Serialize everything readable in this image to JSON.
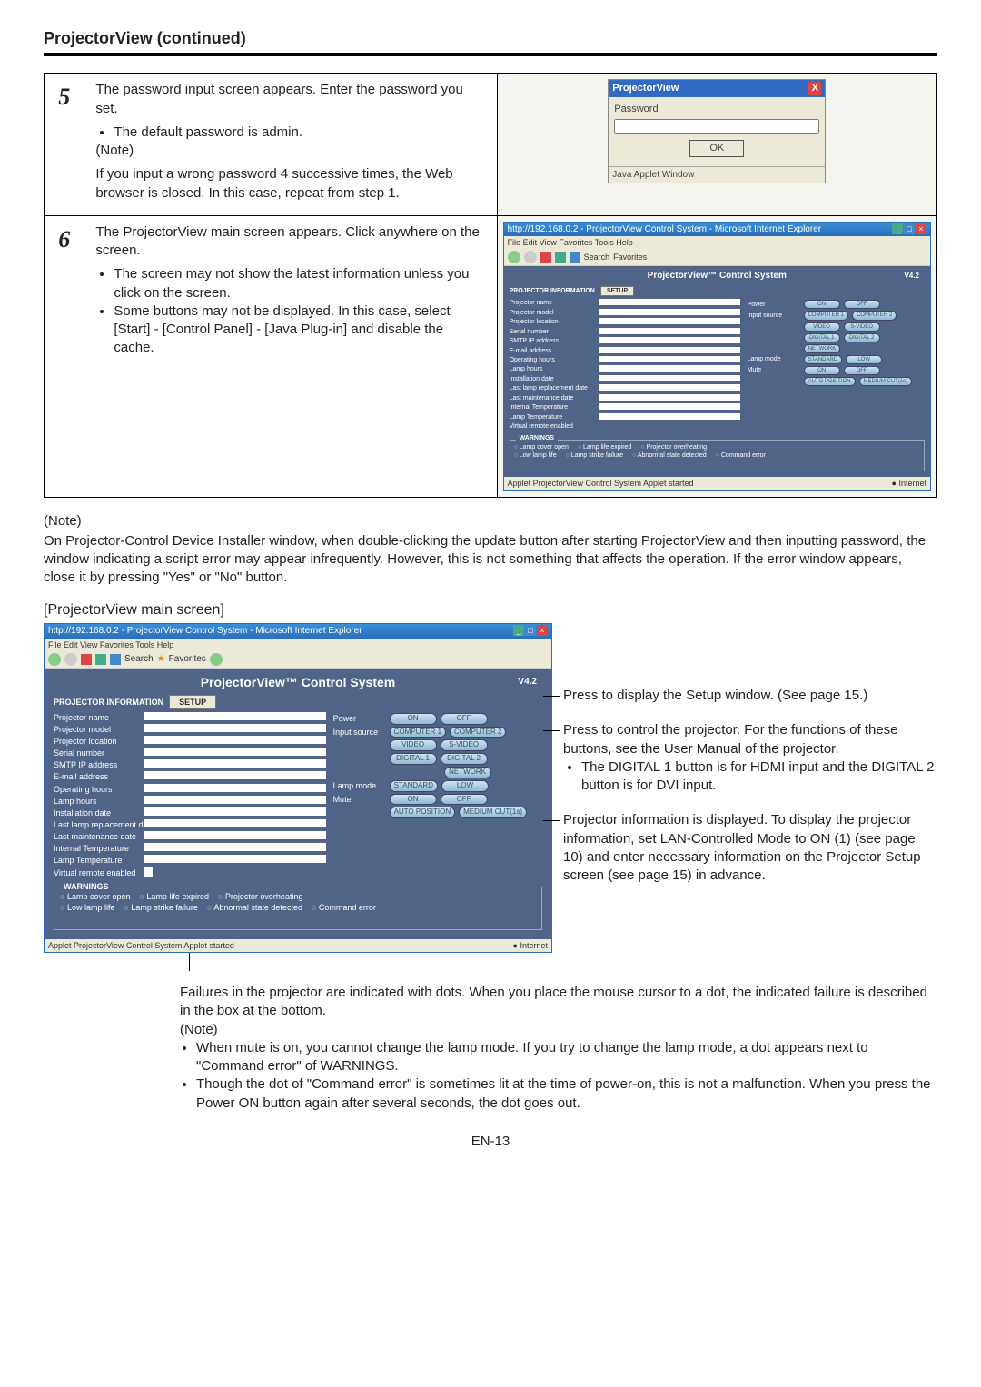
{
  "page": {
    "title": "ProjectorView (continued)",
    "footer": "EN-13",
    "subheading": "[ProjectorView main screen]"
  },
  "step5": {
    "num": "5",
    "p1": "The password input screen appears. Enter the password you set.",
    "li1": "The default password is admin.",
    "note_label": "(Note)",
    "p2": "If you input a wrong password 4 successive times, the Web browser is closed. In this case, repeat from step 1.",
    "dlg": {
      "title": "ProjectorView",
      "close": "X",
      "label": "Password",
      "ok": "OK",
      "status": "Java Applet Window"
    }
  },
  "step6": {
    "num": "6",
    "p1": "The ProjectorView main screen appears. Click anywhere on the screen.",
    "li1": "The screen may not show the latest information unless you click on the screen.",
    "li2": "Some buttons may not be displayed. In this case, select [Start] - [Control Panel] - [Java Plug-in] and disable the cache."
  },
  "outer_note": {
    "label": "(Note)",
    "text": "On Projector-Control Device Installer window, when double-clicking the update button after starting ProjectorView and then inputting password, the window indicating a script error may appear infrequently. However, this is not something that affects the operation. If the error window appears, close it by pressing \"Yes\" or \"No\" button."
  },
  "ie": {
    "title": "http://192.168.0.2 - ProjectorView Control System - Microsoft Internet Explorer",
    "menu": "File   Edit   View   Favorites   Tools   Help",
    "tool_search": "Search",
    "tool_fav": "Favorites",
    "status_left": "Applet ProjectorView Control System Applet started",
    "status_right": "● Internet"
  },
  "pv": {
    "heading": "ProjectorView™ Control System",
    "version": "V4.2",
    "section_info": "PROJECTOR INFORMATION",
    "setup_tab": "SETUP",
    "labels": {
      "name": "Projector name",
      "model": "Projector model",
      "location": "Projector location",
      "serial": "Serial number",
      "smtp": "SMTP IP address",
      "email": "E-mail address",
      "ophours": "Operating hours",
      "lamphours": "Lamp hours",
      "install": "Installation date",
      "lastlamp": "Last lamp replacement date",
      "lastmaint": "Last maintenance date",
      "itemp": "Internal Temperature",
      "ltemp": "Lamp Temperature",
      "vremote": "Virtual remote enabled"
    },
    "ctrl": {
      "power": "Power",
      "on": "ON",
      "off": "OFF",
      "input": "Input source",
      "comp1": "COMPUTER 1",
      "comp2": "COMPUTER 2",
      "video": "VIDEO",
      "svideo": "S-VIDEO",
      "dig1": "DIGITAL 1",
      "dig2": "DIGITAL 2",
      "network": "NETWORK",
      "lampmode": "Lamp mode",
      "std": "STANDARD",
      "low": "LOW",
      "mute": "Mute",
      "mon": "ON",
      "moff": "OFF",
      "autopos": "AUTO POSITION",
      "medcut": "MEDIUM CUT(1s)"
    },
    "warn": {
      "title": "WARNINGS",
      "w1": "Lamp cover open",
      "w2": "Lamp life expired",
      "w3": "Projector overheating",
      "w4": "Low lamp life",
      "w5": "Lamp strike failure",
      "w6": "Abnormal state detected",
      "w7": "Command error"
    }
  },
  "callouts": {
    "c1": "Press to display the Setup window. (See page 15.)",
    "c2a": "Press to control the projector. For the functions of these buttons, see the User Manual of the projector.",
    "c2b": "The DIGITAL 1 button is for HDMI input and the DIGITAL 2 button is for DVI input.",
    "c3": "Projector information is displayed. To display the projector information, set LAN-Controlled Mode to ON (1) (see page 10) and enter necessary information on the Projector Setup screen (see page 15) in advance."
  },
  "bottom": {
    "lead": "Failures in the projector are indicated with dots. When you place the mouse cursor to a dot, the indicated failure is described in the box at the bottom.",
    "note_label": "(Note)",
    "n1": "When mute is on, you cannot change the lamp mode. If you try to change the lamp mode, a dot appears next to \"Command error\" of WARNINGS.",
    "n2": "Though the dot of \"Command error\" is sometimes lit at the time of power-on, this is not a malfunction. When you press the Power ON button again after several seconds, the dot goes out."
  }
}
